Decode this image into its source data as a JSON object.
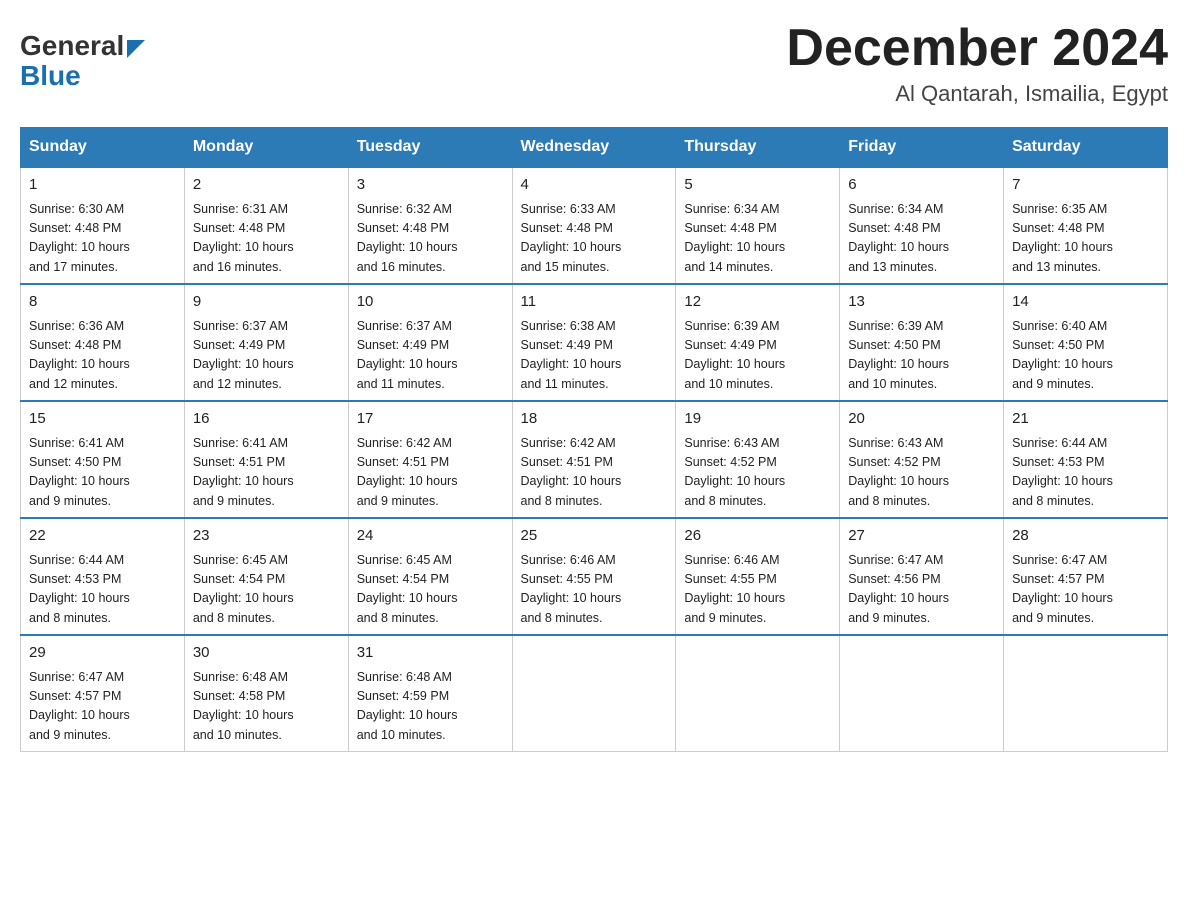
{
  "header": {
    "logo_general": "General",
    "logo_blue": "Blue",
    "title": "December 2024",
    "subtitle": "Al Qantarah, Ismailia, Egypt"
  },
  "days_of_week": [
    "Sunday",
    "Monday",
    "Tuesday",
    "Wednesday",
    "Thursday",
    "Friday",
    "Saturday"
  ],
  "weeks": [
    [
      {
        "day": "1",
        "sunrise": "6:30 AM",
        "sunset": "4:48 PM",
        "daylight": "10 hours and 17 minutes."
      },
      {
        "day": "2",
        "sunrise": "6:31 AM",
        "sunset": "4:48 PM",
        "daylight": "10 hours and 16 minutes."
      },
      {
        "day": "3",
        "sunrise": "6:32 AM",
        "sunset": "4:48 PM",
        "daylight": "10 hours and 16 minutes."
      },
      {
        "day": "4",
        "sunrise": "6:33 AM",
        "sunset": "4:48 PM",
        "daylight": "10 hours and 15 minutes."
      },
      {
        "day": "5",
        "sunrise": "6:34 AM",
        "sunset": "4:48 PM",
        "daylight": "10 hours and 14 minutes."
      },
      {
        "day": "6",
        "sunrise": "6:34 AM",
        "sunset": "4:48 PM",
        "daylight": "10 hours and 13 minutes."
      },
      {
        "day": "7",
        "sunrise": "6:35 AM",
        "sunset": "4:48 PM",
        "daylight": "10 hours and 13 minutes."
      }
    ],
    [
      {
        "day": "8",
        "sunrise": "6:36 AM",
        "sunset": "4:48 PM",
        "daylight": "10 hours and 12 minutes."
      },
      {
        "day": "9",
        "sunrise": "6:37 AM",
        "sunset": "4:49 PM",
        "daylight": "10 hours and 12 minutes."
      },
      {
        "day": "10",
        "sunrise": "6:37 AM",
        "sunset": "4:49 PM",
        "daylight": "10 hours and 11 minutes."
      },
      {
        "day": "11",
        "sunrise": "6:38 AM",
        "sunset": "4:49 PM",
        "daylight": "10 hours and 11 minutes."
      },
      {
        "day": "12",
        "sunrise": "6:39 AM",
        "sunset": "4:49 PM",
        "daylight": "10 hours and 10 minutes."
      },
      {
        "day": "13",
        "sunrise": "6:39 AM",
        "sunset": "4:50 PM",
        "daylight": "10 hours and 10 minutes."
      },
      {
        "day": "14",
        "sunrise": "6:40 AM",
        "sunset": "4:50 PM",
        "daylight": "10 hours and 9 minutes."
      }
    ],
    [
      {
        "day": "15",
        "sunrise": "6:41 AM",
        "sunset": "4:50 PM",
        "daylight": "10 hours and 9 minutes."
      },
      {
        "day": "16",
        "sunrise": "6:41 AM",
        "sunset": "4:51 PM",
        "daylight": "10 hours and 9 minutes."
      },
      {
        "day": "17",
        "sunrise": "6:42 AM",
        "sunset": "4:51 PM",
        "daylight": "10 hours and 9 minutes."
      },
      {
        "day": "18",
        "sunrise": "6:42 AM",
        "sunset": "4:51 PM",
        "daylight": "10 hours and 8 minutes."
      },
      {
        "day": "19",
        "sunrise": "6:43 AM",
        "sunset": "4:52 PM",
        "daylight": "10 hours and 8 minutes."
      },
      {
        "day": "20",
        "sunrise": "6:43 AM",
        "sunset": "4:52 PM",
        "daylight": "10 hours and 8 minutes."
      },
      {
        "day": "21",
        "sunrise": "6:44 AM",
        "sunset": "4:53 PM",
        "daylight": "10 hours and 8 minutes."
      }
    ],
    [
      {
        "day": "22",
        "sunrise": "6:44 AM",
        "sunset": "4:53 PM",
        "daylight": "10 hours and 8 minutes."
      },
      {
        "day": "23",
        "sunrise": "6:45 AM",
        "sunset": "4:54 PM",
        "daylight": "10 hours and 8 minutes."
      },
      {
        "day": "24",
        "sunrise": "6:45 AM",
        "sunset": "4:54 PM",
        "daylight": "10 hours and 8 minutes."
      },
      {
        "day": "25",
        "sunrise": "6:46 AM",
        "sunset": "4:55 PM",
        "daylight": "10 hours and 8 minutes."
      },
      {
        "day": "26",
        "sunrise": "6:46 AM",
        "sunset": "4:55 PM",
        "daylight": "10 hours and 9 minutes."
      },
      {
        "day": "27",
        "sunrise": "6:47 AM",
        "sunset": "4:56 PM",
        "daylight": "10 hours and 9 minutes."
      },
      {
        "day": "28",
        "sunrise": "6:47 AM",
        "sunset": "4:57 PM",
        "daylight": "10 hours and 9 minutes."
      }
    ],
    [
      {
        "day": "29",
        "sunrise": "6:47 AM",
        "sunset": "4:57 PM",
        "daylight": "10 hours and 9 minutes."
      },
      {
        "day": "30",
        "sunrise": "6:48 AM",
        "sunset": "4:58 PM",
        "daylight": "10 hours and 10 minutes."
      },
      {
        "day": "31",
        "sunrise": "6:48 AM",
        "sunset": "4:59 PM",
        "daylight": "10 hours and 10 minutes."
      },
      null,
      null,
      null,
      null
    ]
  ],
  "labels": {
    "sunrise": "Sunrise:",
    "sunset": "Sunset:",
    "daylight": "Daylight:"
  },
  "colors": {
    "header_bg": "#2c7bb6",
    "border_top": "#2c7bb6"
  }
}
